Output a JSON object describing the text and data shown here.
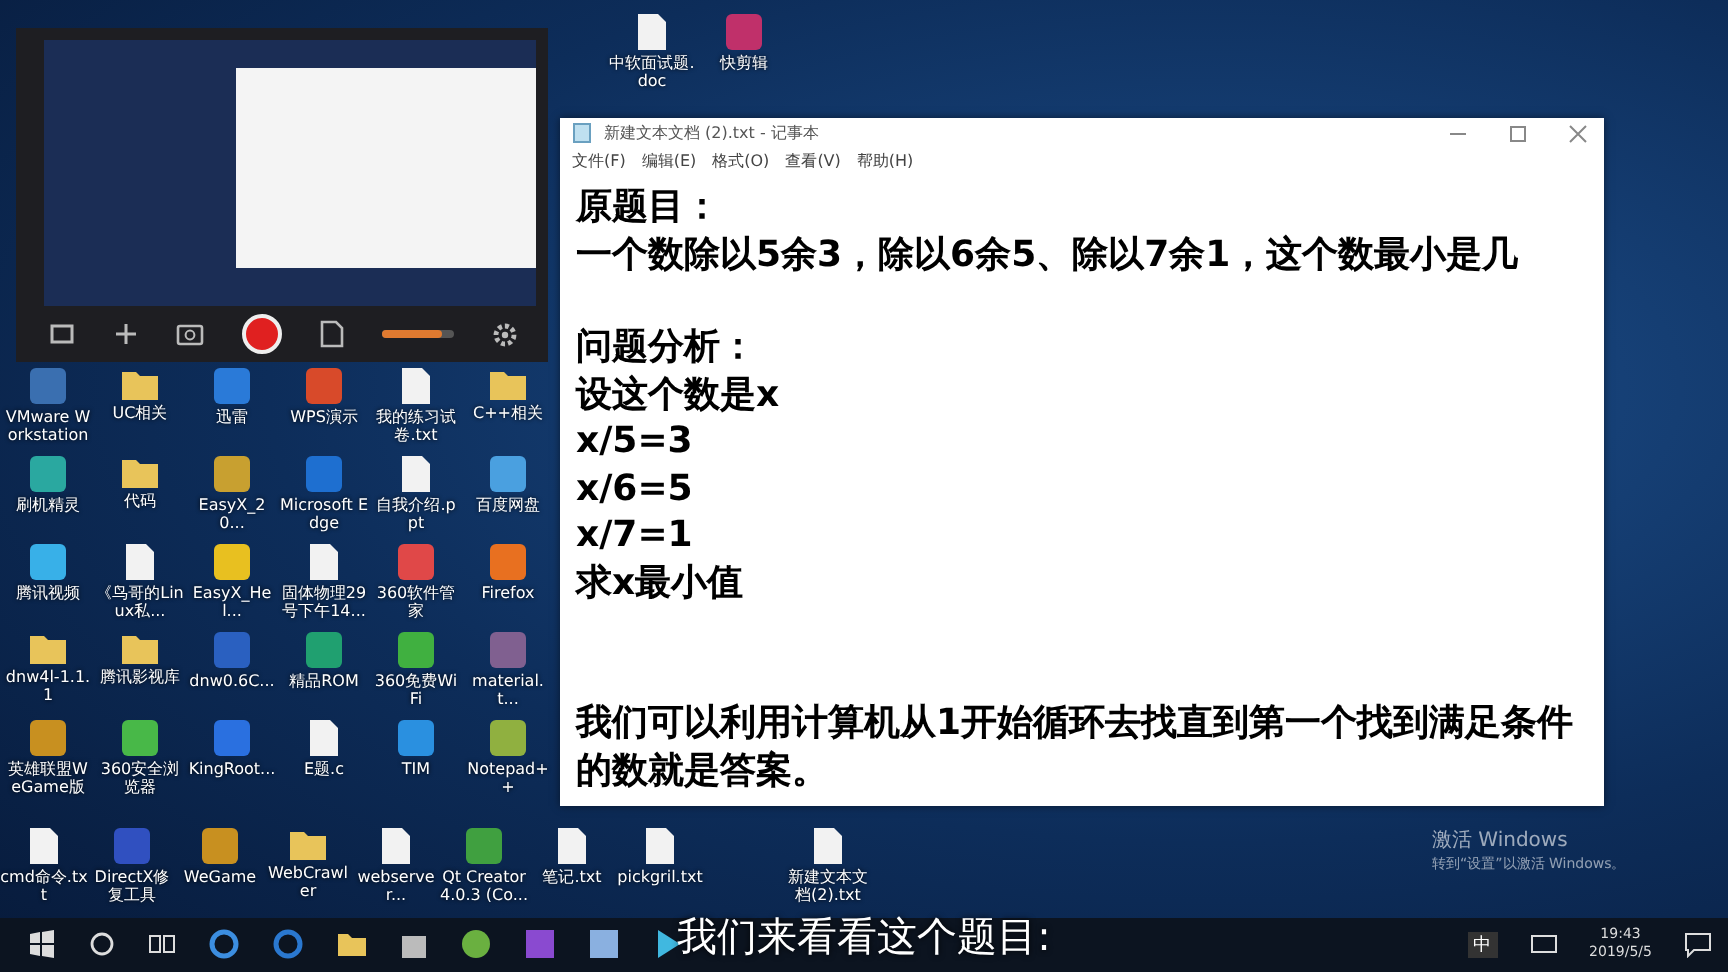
{
  "desktop_top_icons": [
    {
      "label": "中软面试题.doc",
      "kind": "file"
    },
    {
      "label": "快剪辑",
      "kind": "app",
      "color": "#c0306a"
    }
  ],
  "desktop_grid": [
    {
      "label": "VMware Workstation",
      "kind": "app",
      "color": "#3a6fb0"
    },
    {
      "label": "UC相关",
      "kind": "folder"
    },
    {
      "label": "迅雷",
      "kind": "app",
      "color": "#2a7ad8"
    },
    {
      "label": "WPS演示",
      "kind": "app",
      "color": "#d84a2a"
    },
    {
      "label": "我的练习试卷.txt",
      "kind": "file"
    },
    {
      "label": "C++相关",
      "kind": "folder"
    },
    {
      "label": "刷机精灵",
      "kind": "app",
      "color": "#2aa8a0"
    },
    {
      "label": "代码",
      "kind": "folder"
    },
    {
      "label": "EasyX_20...",
      "kind": "app",
      "color": "#c8a030"
    },
    {
      "label": "Microsoft Edge",
      "kind": "app",
      "color": "#1e6fd0"
    },
    {
      "label": "自我介绍.ppt",
      "kind": "file"
    },
    {
      "label": "百度网盘",
      "kind": "app",
      "color": "#4aa0e0"
    },
    {
      "label": "腾讯视频",
      "kind": "app",
      "color": "#38b0e8"
    },
    {
      "label": "《鸟哥的Linux私...",
      "kind": "file"
    },
    {
      "label": "EasyX_Hel...",
      "kind": "app",
      "color": "#e8c020"
    },
    {
      "label": "固体物理29号下午14...",
      "kind": "file"
    },
    {
      "label": "360软件管家",
      "kind": "app",
      "color": "#e04848"
    },
    {
      "label": "Firefox",
      "kind": "app",
      "color": "#e87020"
    },
    {
      "label": "dnw4l-1.1.1",
      "kind": "folder"
    },
    {
      "label": "腾讯影视库",
      "kind": "folder"
    },
    {
      "label": "dnw0.6C...",
      "kind": "app",
      "color": "#2a60c0"
    },
    {
      "label": "精品ROM",
      "kind": "app",
      "color": "#20a070"
    },
    {
      "label": "360免费WiFi",
      "kind": "app",
      "color": "#40b040"
    },
    {
      "label": "material.t...",
      "kind": "app",
      "color": "#806090"
    },
    {
      "label": "英雄联盟WeGame版",
      "kind": "app",
      "color": "#c89020"
    },
    {
      "label": "360安全浏览器",
      "kind": "app",
      "color": "#48b848"
    },
    {
      "label": "KingRoot...",
      "kind": "app",
      "color": "#2a70e0"
    },
    {
      "label": "E题.c",
      "kind": "file"
    },
    {
      "label": "TIM",
      "kind": "app",
      "color": "#2a90e0"
    },
    {
      "label": "Notepad++",
      "kind": "app",
      "color": "#90b040"
    }
  ],
  "desktop_bottom_icons": [
    {
      "label": "cmd命令.txt",
      "kind": "file"
    },
    {
      "label": "DirectX修复工具",
      "kind": "app",
      "color": "#3050c0"
    },
    {
      "label": "WeGame",
      "kind": "app",
      "color": "#c89020"
    },
    {
      "label": "WebCrawler",
      "kind": "folder"
    },
    {
      "label": "webserver...",
      "kind": "file"
    },
    {
      "label": "Qt Creator 4.0.3 (Co...",
      "kind": "app",
      "color": "#40a040"
    },
    {
      "label": "笔记.txt",
      "kind": "file"
    },
    {
      "label": "pickgril.txt",
      "kind": "file"
    },
    {
      "label": "新建文本文档(2).txt",
      "kind": "file"
    }
  ],
  "notepad": {
    "title": "新建文本文档 (2).txt - 记事本",
    "menu": [
      "文件(F)",
      "编辑(E)",
      "格式(O)",
      "查看(V)",
      "帮助(H)"
    ],
    "paragraphs": [
      [
        "原题目：",
        "一个数除以5余3，除以6余5、除以7余1，这个数最小是几"
      ],
      [
        "问题分析：",
        "设这个数是x",
        "x/5=3",
        "x/6=5",
        "x/7=1",
        "求x最小值"
      ],
      [
        "我们可以利用计算机从1开始循环去找直到第一个找到满足条件的数就是答案。"
      ]
    ]
  },
  "activation": {
    "title": "激活 Windows",
    "hint": "转到“设置”以激活 Windows。"
  },
  "recorder": {
    "volume": {
      "level": 0.85
    }
  },
  "subtitle": "我们来看看这个题目:",
  "taskbar": {
    "ime": "中",
    "time": "19:43",
    "date": "2019/5/5"
  }
}
